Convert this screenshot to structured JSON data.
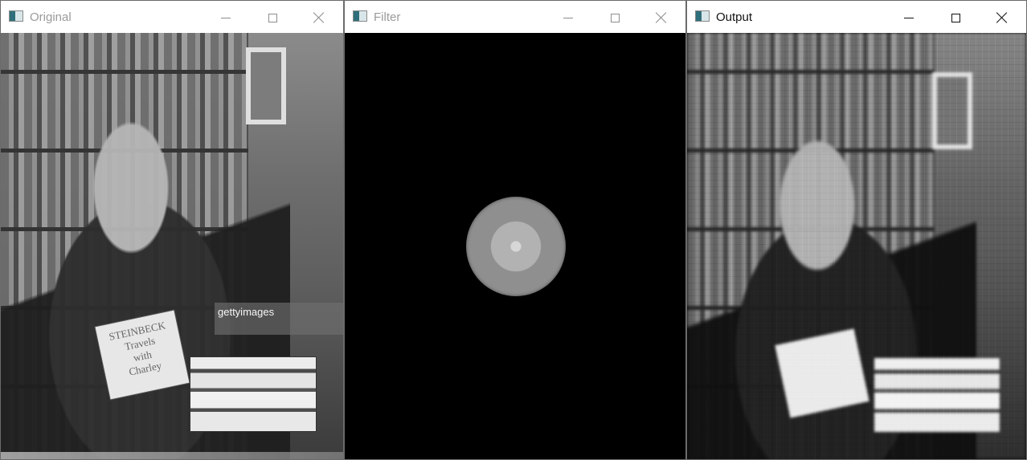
{
  "windows": [
    {
      "title": "Original",
      "controls": {
        "minimize": "minimize",
        "maximize": "maximize",
        "close": "close"
      },
      "content": {
        "book_title_line1": "STEINBECK",
        "book_title_line2": "Travels",
        "book_title_line3": "with",
        "book_title_line4": "Charley",
        "watermark_brand": "gettyimages"
      }
    },
    {
      "title": "Filter",
      "controls": {
        "minimize": "minimize",
        "maximize": "maximize",
        "close": "close"
      }
    },
    {
      "title": "Output",
      "controls": {
        "minimize": "minimize",
        "maximize": "maximize",
        "close": "close"
      }
    }
  ],
  "icons": {
    "window": "app-window-icon",
    "minimize": "minimize-icon",
    "maximize": "maximize-icon",
    "close": "close-icon"
  }
}
